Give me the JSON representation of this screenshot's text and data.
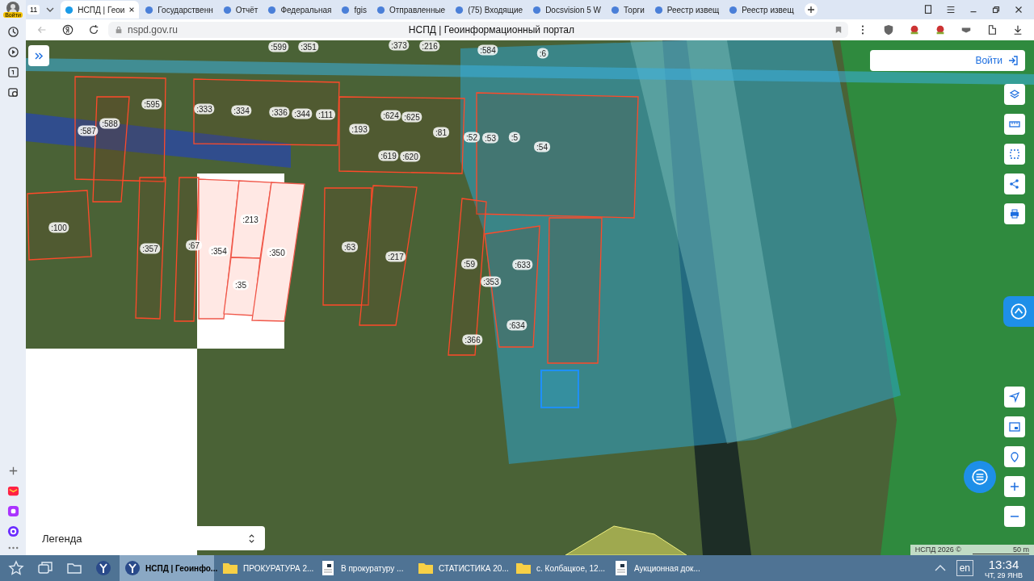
{
  "browser": {
    "profile_badge": "Войти",
    "tab_counter": "11",
    "tabs": [
      {
        "title": "НСПД | Геои",
        "selected": true
      },
      {
        "title": "Государственн",
        "selected": false
      },
      {
        "title": "Отчёт",
        "selected": false
      },
      {
        "title": "Федеральная",
        "selected": false
      },
      {
        "title": "fgis",
        "selected": false
      },
      {
        "title": "Отправленные",
        "selected": false
      },
      {
        "title": "(75) Входящие",
        "selected": false
      },
      {
        "title": "Docsvision 5 W",
        "selected": false
      },
      {
        "title": "Торги",
        "selected": false
      },
      {
        "title": "Реестр извещ",
        "selected": false
      },
      {
        "title": "Реестр извещ",
        "selected": false
      }
    ],
    "address": "nspd.gov.ru",
    "page_title": "НСПД | Геоинформационный портал"
  },
  "map": {
    "login_button": "Войти",
    "legend": "Легенда",
    "attribution": "НСПД 2026 ©",
    "scale": "50 m",
    "parcel_labels": [
      ":599",
      ":351",
      ":373",
      ":216",
      ":584",
      ":6",
      ":595",
      ":333",
      ":334",
      ":336",
      ":344",
      ":111",
      ":193",
      ":624",
      ":625",
      ":81",
      ":52",
      ":53",
      ":5",
      ":54",
      ":619",
      ":620",
      ":588",
      ":587",
      ":100",
      ":357",
      ":67",
      ":354",
      ":213",
      ":35",
      ":350",
      ":63",
      ":217",
      ":59",
      ":353",
      ":633",
      ":634",
      ":366"
    ]
  },
  "taskbar": {
    "items": [
      {
        "label": "НСПД | Геоинфо...",
        "kind": "browser",
        "selected": true
      },
      {
        "label": "ПРОКУРАТУРА 2...",
        "kind": "folder",
        "selected": false
      },
      {
        "label": "В прокуратуру ...",
        "kind": "document",
        "selected": false
      },
      {
        "label": "СТАТИСТИКА 20...",
        "kind": "folder",
        "selected": false
      },
      {
        "label": "с. Колбацкое, 12...",
        "kind": "folder",
        "selected": false
      },
      {
        "label": "Аукционная док...",
        "kind": "document",
        "selected": false
      }
    ],
    "language": "en",
    "time": "13:34",
    "date": "ЧТ, 29 ЯНВ"
  }
}
